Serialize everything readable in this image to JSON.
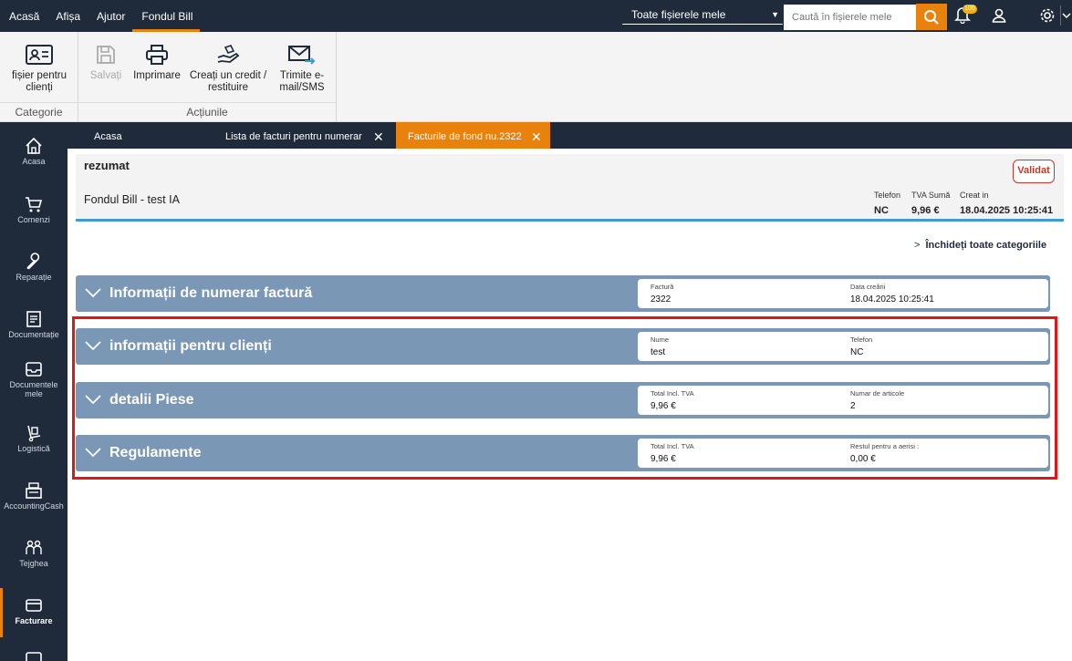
{
  "topnav": [
    {
      "label": "Acasă"
    },
    {
      "label": "Afișa"
    },
    {
      "label": "Ajutor"
    },
    {
      "label": "Fondul Bill",
      "active": true
    }
  ],
  "search": {
    "scope": "Toate fișierele mele",
    "placeholder": "Caută în fișierele mele"
  },
  "notifications": {
    "badge": "100"
  },
  "ribbon": {
    "category_group": {
      "button_label": "fișier pentru clienți",
      "label": "Categorie"
    },
    "actions_group": {
      "label": "Acțiunile",
      "buttons": [
        {
          "label": "Salvați",
          "disabled": true
        },
        {
          "label": "Imprimare"
        },
        {
          "label": "Creați un credit / restituire"
        },
        {
          "label": "Trimite e-mail/SMS"
        }
      ]
    }
  },
  "sidebar": [
    {
      "label": "Acasa",
      "icon": "home-icon"
    },
    {
      "label": "Comenzi",
      "icon": "cart-icon"
    },
    {
      "label": "Reparație",
      "icon": "wrench-icon"
    },
    {
      "label": "Documentație",
      "icon": "document-icon"
    },
    {
      "label": "Documentele mele",
      "icon": "inbox-icon"
    },
    {
      "label": "Logistică",
      "icon": "dolly-icon"
    },
    {
      "label": "AccountingCash",
      "icon": "cash-register-icon"
    },
    {
      "label": "Tejghea",
      "icon": "people-icon"
    },
    {
      "label": "Facturare",
      "icon": "card-icon",
      "active": true
    }
  ],
  "tabs": [
    {
      "label": "Acasa"
    },
    {
      "label": "Lista de facturi pentru numerar",
      "closable": true
    },
    {
      "label": "Facturile de fond nu.2322",
      "closable": true,
      "active": true
    }
  ],
  "summary": {
    "title": "rezumat",
    "name": "Fondul Bill - test IA",
    "validate_label": "Validat",
    "fields": [
      {
        "label": "Telefon",
        "value": "NC"
      },
      {
        "label": "TVA Sumă",
        "value": "9,96 €"
      },
      {
        "label": "Creat in",
        "value": "18.04.2025 10:25:41"
      }
    ]
  },
  "collapse_all": "Închideți toate categoriile",
  "sections": [
    {
      "title": "Informații de numerar factură",
      "fields": [
        {
          "label": "Factură",
          "value": "2322"
        },
        {
          "label": "Data creării",
          "value": "18.04.2025 10:25:41"
        }
      ]
    },
    {
      "title": "informații pentru clienți",
      "fields": [
        {
          "label": "Nume",
          "value": "test"
        },
        {
          "label": "Telefon",
          "value": "NC"
        }
      ]
    },
    {
      "title": "detalii Piese",
      "fields": [
        {
          "label": "Total Incl. TVA",
          "value": "9,96 €"
        },
        {
          "label": "Numar de articole",
          "value": "2"
        }
      ]
    },
    {
      "title": "Regulamente",
      "fields": [
        {
          "label": "Total Incl. TVA",
          "value": "9,96 €"
        },
        {
          "label": "Restul pentru a aerisi :",
          "value": "0,00 €"
        }
      ]
    }
  ],
  "colors": {
    "accent": "#e8820c",
    "nav_bg": "#1f2b3b",
    "section_bg": "#7b97b6",
    "highlight": "#e0161b",
    "summary_rule": "#3d9bd0"
  }
}
